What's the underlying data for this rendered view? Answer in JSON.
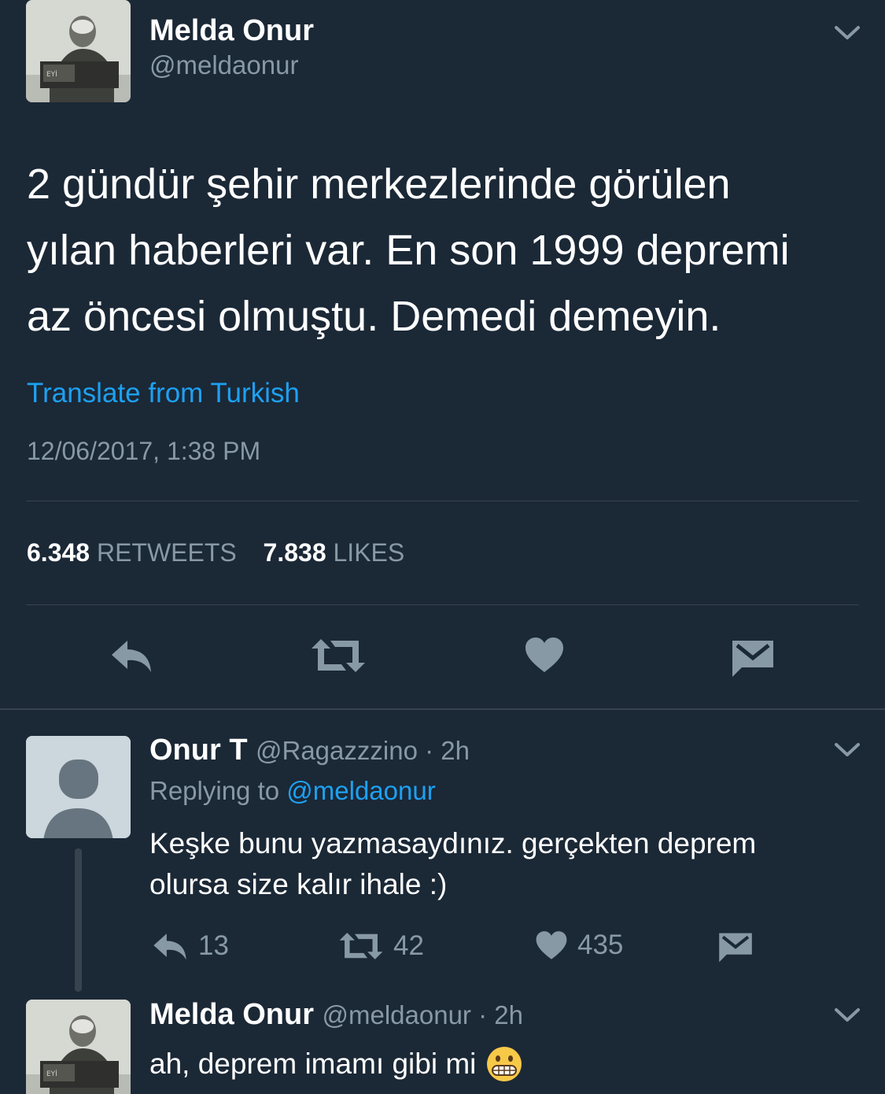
{
  "main_tweet": {
    "author_name": "Melda Onur",
    "author_handle": "@meldaonur",
    "text_lines": [
      "2 gündür şehir merkezlerinde görülen",
      "yılan haberleri var. En son 1999 depremi",
      "az öncesi olmuştu. Demedi demeyin."
    ],
    "translate_label": "Translate from Turkish",
    "timestamp": "12/06/2017, 1:38 PM",
    "retweet_count": "6.348",
    "retweet_label": "RETWEETS",
    "like_count": "7.838",
    "like_label": "LIKES",
    "icons": [
      "reply-icon",
      "retweet-icon",
      "heart-icon",
      "dm-icon",
      "chevron-down-icon"
    ]
  },
  "reply_1": {
    "author_name": "Onur T",
    "author_handle": "@Ragazzzino",
    "separator": " · ",
    "time": "2h",
    "replying_prefix": "Replying to",
    "replying_handle": "@meldaonur",
    "text_lines": [
      "Keşke bunu yazmasaydınız. gerçekten deprem",
      "olursa size kalır ihale :)"
    ],
    "reply_count": "13",
    "retweet_count": "42",
    "like_count": "435"
  },
  "reply_2": {
    "author_name": "Melda Onur",
    "author_handle": "@meldaonur",
    "separator": " · ",
    "time": "2h",
    "text": "ah, deprem imamı gibi mi",
    "emoji": "grimacing-face"
  },
  "colors": {
    "background": "#1b2836",
    "text": "#ffffff",
    "muted": "#8899a6",
    "link": "#1da1f2",
    "divider": "#38444d"
  }
}
